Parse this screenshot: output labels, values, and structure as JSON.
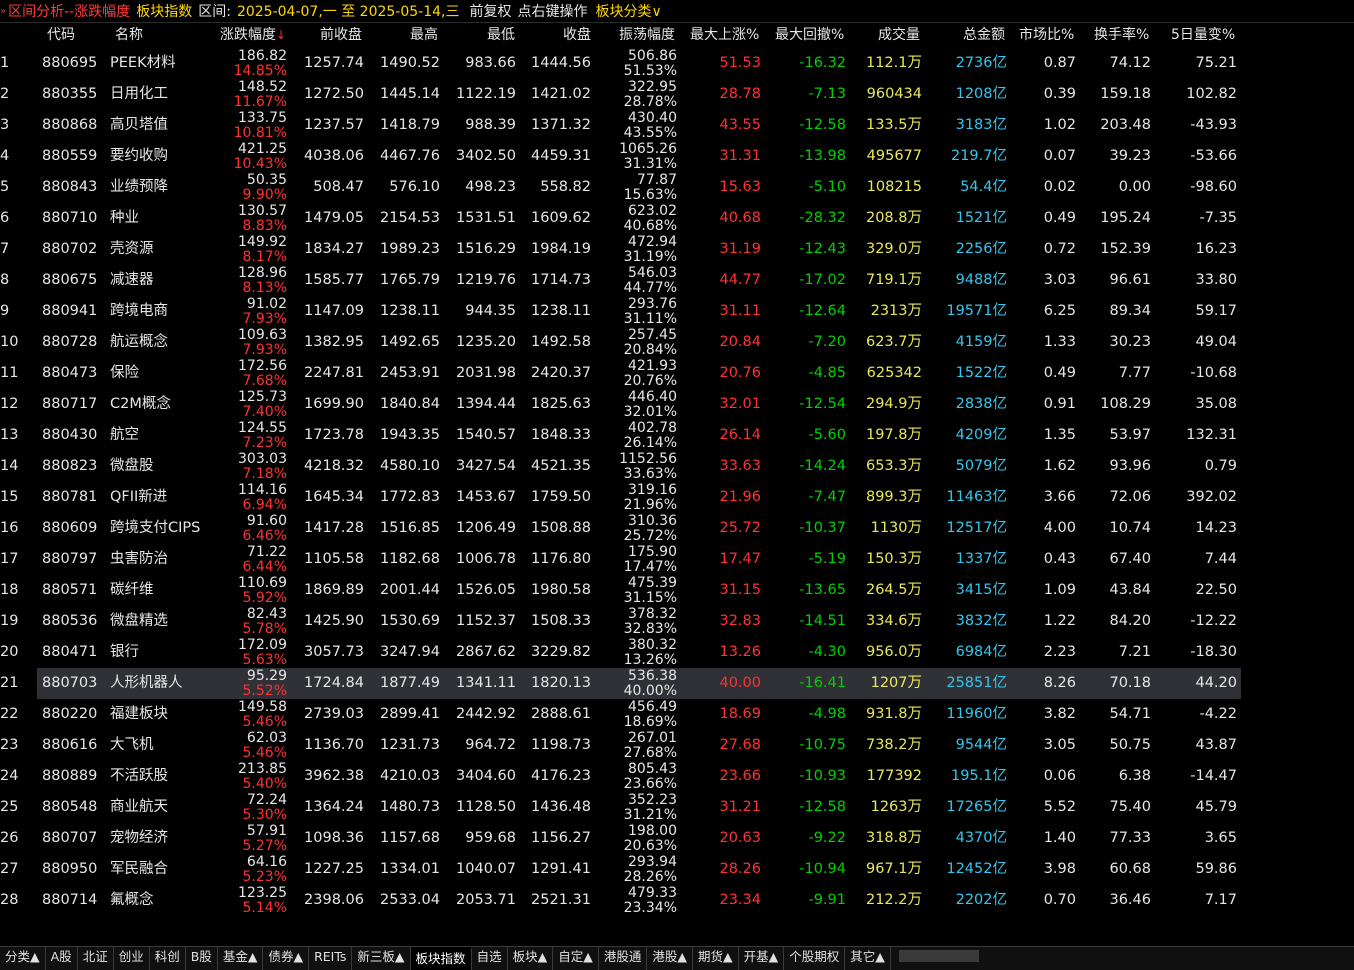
{
  "topbar": {
    "title": "区间分析--涨跌幅度",
    "board": "板块指数",
    "range_label": "区间:",
    "range_value": "2025-04-07,一 至 2025-05-14,三",
    "option1": "前复权",
    "option2": "点右键操作",
    "category": "板块分类∨"
  },
  "columns": {
    "code": "代码",
    "name": "名称",
    "change": "涨跌幅度",
    "sort_arrow": "↓",
    "prev_close": "前收盘",
    "high": "最高",
    "low": "最低",
    "close": "收盘",
    "amplitude": "振荡幅度",
    "max_rise": "最大上涨%",
    "max_drawdown": "最大回撤%",
    "volume": "成交量",
    "amount": "总金额",
    "market_ratio": "市场比%",
    "turnover": "换手率%",
    "vol5": "5日量变%"
  },
  "rows": [
    {
      "idx": "1",
      "code": "880695",
      "name": "PEEK材料",
      "chg": "186.82",
      "chg_pct": "14.85%",
      "prev": "1257.74",
      "high": "1490.52",
      "low": "983.66",
      "close": "1444.56",
      "amp": "506.86",
      "amp_pct": "51.53%",
      "rise": "51.53",
      "dd": "-16.32",
      "vol": "112.1万",
      "amt": "2736亿",
      "mkt": "0.87",
      "turn": "74.12",
      "v5": "75.21"
    },
    {
      "idx": "2",
      "code": "880355",
      "name": "日用化工",
      "chg": "148.52",
      "chg_pct": "11.67%",
      "prev": "1272.50",
      "high": "1445.14",
      "low": "1122.19",
      "close": "1421.02",
      "amp": "322.95",
      "amp_pct": "28.78%",
      "rise": "28.78",
      "dd": "-7.13",
      "vol": "960434",
      "amt": "1208亿",
      "mkt": "0.39",
      "turn": "159.18",
      "v5": "102.82"
    },
    {
      "idx": "3",
      "code": "880868",
      "name": "高贝塔值",
      "chg": "133.75",
      "chg_pct": "10.81%",
      "prev": "1237.57",
      "high": "1418.79",
      "low": "988.39",
      "close": "1371.32",
      "amp": "430.40",
      "amp_pct": "43.55%",
      "rise": "43.55",
      "dd": "-12.58",
      "vol": "133.5万",
      "amt": "3183亿",
      "mkt": "1.02",
      "turn": "203.48",
      "v5": "-43.93"
    },
    {
      "idx": "4",
      "code": "880559",
      "name": "要约收购",
      "chg": "421.25",
      "chg_pct": "10.43%",
      "prev": "4038.06",
      "high": "4467.76",
      "low": "3402.50",
      "close": "4459.31",
      "amp": "1065.26",
      "amp_pct": "31.31%",
      "rise": "31.31",
      "dd": "-13.98",
      "vol": "495677",
      "amt": "219.7亿",
      "mkt": "0.07",
      "turn": "39.23",
      "v5": "-53.66"
    },
    {
      "idx": "5",
      "code": "880843",
      "name": "业绩预降",
      "chg": "50.35",
      "chg_pct": "9.90%",
      "prev": "508.47",
      "high": "576.10",
      "low": "498.23",
      "close": "558.82",
      "amp": "77.87",
      "amp_pct": "15.63%",
      "rise": "15.63",
      "dd": "-5.10",
      "vol": "108215",
      "amt": "54.4亿",
      "mkt": "0.02",
      "turn": "0.00",
      "v5": "-98.60"
    },
    {
      "idx": "6",
      "code": "880710",
      "name": "种业",
      "chg": "130.57",
      "chg_pct": "8.83%",
      "prev": "1479.05",
      "high": "2154.53",
      "low": "1531.51",
      "close": "1609.62",
      "amp": "623.02",
      "amp_pct": "40.68%",
      "rise": "40.68",
      "dd": "-28.32",
      "vol": "208.8万",
      "amt": "1521亿",
      "mkt": "0.49",
      "turn": "195.24",
      "v5": "-7.35"
    },
    {
      "idx": "7",
      "code": "880702",
      "name": "壳资源",
      "chg": "149.92",
      "chg_pct": "8.17%",
      "prev": "1834.27",
      "high": "1989.23",
      "low": "1516.29",
      "close": "1984.19",
      "amp": "472.94",
      "amp_pct": "31.19%",
      "rise": "31.19",
      "dd": "-12.43",
      "vol": "329.0万",
      "amt": "2256亿",
      "mkt": "0.72",
      "turn": "152.39",
      "v5": "16.23"
    },
    {
      "idx": "8",
      "code": "880675",
      "name": "减速器",
      "chg": "128.96",
      "chg_pct": "8.13%",
      "prev": "1585.77",
      "high": "1765.79",
      "low": "1219.76",
      "close": "1714.73",
      "amp": "546.03",
      "amp_pct": "44.77%",
      "rise": "44.77",
      "dd": "-17.02",
      "vol": "719.1万",
      "amt": "9488亿",
      "mkt": "3.03",
      "turn": "96.61",
      "v5": "33.80"
    },
    {
      "idx": "9",
      "code": "880941",
      "name": "跨境电商",
      "chg": "91.02",
      "chg_pct": "7.93%",
      "prev": "1147.09",
      "high": "1238.11",
      "low": "944.35",
      "close": "1238.11",
      "amp": "293.76",
      "amp_pct": "31.11%",
      "rise": "31.11",
      "dd": "-12.64",
      "vol": "2313万",
      "amt": "19571亿",
      "mkt": "6.25",
      "turn": "89.34",
      "v5": "59.17"
    },
    {
      "idx": "10",
      "code": "880728",
      "name": "航运概念",
      "chg": "109.63",
      "chg_pct": "7.93%",
      "prev": "1382.95",
      "high": "1492.65",
      "low": "1235.20",
      "close": "1492.58",
      "amp": "257.45",
      "amp_pct": "20.84%",
      "rise": "20.84",
      "dd": "-7.20",
      "vol": "623.7万",
      "amt": "4159亿",
      "mkt": "1.33",
      "turn": "30.23",
      "v5": "49.04"
    },
    {
      "idx": "11",
      "code": "880473",
      "name": "保险",
      "chg": "172.56",
      "chg_pct": "7.68%",
      "prev": "2247.81",
      "high": "2453.91",
      "low": "2031.98",
      "close": "2420.37",
      "amp": "421.93",
      "amp_pct": "20.76%",
      "rise": "20.76",
      "dd": "-4.85",
      "vol": "625342",
      "amt": "1522亿",
      "mkt": "0.49",
      "turn": "7.77",
      "v5": "-10.68"
    },
    {
      "idx": "12",
      "code": "880717",
      "name": "C2M概念",
      "chg": "125.73",
      "chg_pct": "7.40%",
      "prev": "1699.90",
      "high": "1840.84",
      "low": "1394.44",
      "close": "1825.63",
      "amp": "446.40",
      "amp_pct": "32.01%",
      "rise": "32.01",
      "dd": "-12.54",
      "vol": "294.9万",
      "amt": "2838亿",
      "mkt": "0.91",
      "turn": "108.29",
      "v5": "35.08"
    },
    {
      "idx": "13",
      "code": "880430",
      "name": "航空",
      "chg": "124.55",
      "chg_pct": "7.23%",
      "prev": "1723.78",
      "high": "1943.35",
      "low": "1540.57",
      "close": "1848.33",
      "amp": "402.78",
      "amp_pct": "26.14%",
      "rise": "26.14",
      "dd": "-5.60",
      "vol": "197.8万",
      "amt": "4209亿",
      "mkt": "1.35",
      "turn": "53.97",
      "v5": "132.31"
    },
    {
      "idx": "14",
      "code": "880823",
      "name": "微盘股",
      "chg": "303.03",
      "chg_pct": "7.18%",
      "prev": "4218.32",
      "high": "4580.10",
      "low": "3427.54",
      "close": "4521.35",
      "amp": "1152.56",
      "amp_pct": "33.63%",
      "rise": "33.63",
      "dd": "-14.24",
      "vol": "653.3万",
      "amt": "5079亿",
      "mkt": "1.62",
      "turn": "93.96",
      "v5": "0.79"
    },
    {
      "idx": "15",
      "code": "880781",
      "name": "QFII新进",
      "chg": "114.16",
      "chg_pct": "6.94%",
      "prev": "1645.34",
      "high": "1772.83",
      "low": "1453.67",
      "close": "1759.50",
      "amp": "319.16",
      "amp_pct": "21.96%",
      "rise": "21.96",
      "dd": "-7.47",
      "vol": "899.3万",
      "amt": "11463亿",
      "mkt": "3.66",
      "turn": "72.06",
      "v5": "392.02"
    },
    {
      "idx": "16",
      "code": "880609",
      "name": "跨境支付CIPS",
      "chg": "91.60",
      "chg_pct": "6.46%",
      "prev": "1417.28",
      "high": "1516.85",
      "low": "1206.49",
      "close": "1508.88",
      "amp": "310.36",
      "amp_pct": "25.72%",
      "rise": "25.72",
      "dd": "-10.37",
      "vol": "1130万",
      "amt": "12517亿",
      "mkt": "4.00",
      "turn": "10.74",
      "v5": "14.23"
    },
    {
      "idx": "17",
      "code": "880797",
      "name": "虫害防治",
      "chg": "71.22",
      "chg_pct": "6.44%",
      "prev": "1105.58",
      "high": "1182.68",
      "low": "1006.78",
      "close": "1176.80",
      "amp": "175.90",
      "amp_pct": "17.47%",
      "rise": "17.47",
      "dd": "-5.19",
      "vol": "150.3万",
      "amt": "1337亿",
      "mkt": "0.43",
      "turn": "67.40",
      "v5": "7.44"
    },
    {
      "idx": "18",
      "code": "880571",
      "name": "碳纤维",
      "chg": "110.69",
      "chg_pct": "5.92%",
      "prev": "1869.89",
      "high": "2001.44",
      "low": "1526.05",
      "close": "1980.58",
      "amp": "475.39",
      "amp_pct": "31.15%",
      "rise": "31.15",
      "dd": "-13.65",
      "vol": "264.5万",
      "amt": "3415亿",
      "mkt": "1.09",
      "turn": "43.84",
      "v5": "22.50"
    },
    {
      "idx": "19",
      "code": "880536",
      "name": "微盘精选",
      "chg": "82.43",
      "chg_pct": "5.78%",
      "prev": "1425.90",
      "high": "1530.69",
      "low": "1152.37",
      "close": "1508.33",
      "amp": "378.32",
      "amp_pct": "32.83%",
      "rise": "32.83",
      "dd": "-14.51",
      "vol": "334.6万",
      "amt": "3832亿",
      "mkt": "1.22",
      "turn": "84.20",
      "v5": "-12.22"
    },
    {
      "idx": "20",
      "code": "880471",
      "name": "银行",
      "chg": "172.09",
      "chg_pct": "5.63%",
      "prev": "3057.73",
      "high": "3247.94",
      "low": "2867.62",
      "close": "3229.82",
      "amp": "380.32",
      "amp_pct": "13.26%",
      "rise": "13.26",
      "dd": "-4.30",
      "vol": "956.0万",
      "amt": "6984亿",
      "mkt": "2.23",
      "turn": "7.21",
      "v5": "-18.30"
    },
    {
      "idx": "21",
      "code": "880703",
      "name": "人形机器人",
      "chg": "95.29",
      "chg_pct": "5.52%",
      "prev": "1724.84",
      "high": "1877.49",
      "low": "1341.11",
      "close": "1820.13",
      "amp": "536.38",
      "amp_pct": "40.00%",
      "rise": "40.00",
      "dd": "-16.41",
      "vol": "1207万",
      "amt": "25851亿",
      "mkt": "8.26",
      "turn": "70.18",
      "v5": "44.20",
      "selected": true
    },
    {
      "idx": "22",
      "code": "880220",
      "name": "福建板块",
      "chg": "149.58",
      "chg_pct": "5.46%",
      "prev": "2739.03",
      "high": "2899.41",
      "low": "2442.92",
      "close": "2888.61",
      "amp": "456.49",
      "amp_pct": "18.69%",
      "rise": "18.69",
      "dd": "-4.98",
      "vol": "931.8万",
      "amt": "11960亿",
      "mkt": "3.82",
      "turn": "54.71",
      "v5": "-4.22"
    },
    {
      "idx": "23",
      "code": "880616",
      "name": "大飞机",
      "chg": "62.03",
      "chg_pct": "5.46%",
      "prev": "1136.70",
      "high": "1231.73",
      "low": "964.72",
      "close": "1198.73",
      "amp": "267.01",
      "amp_pct": "27.68%",
      "rise": "27.68",
      "dd": "-10.75",
      "vol": "738.2万",
      "amt": "9544亿",
      "mkt": "3.05",
      "turn": "50.75",
      "v5": "43.87"
    },
    {
      "idx": "24",
      "code": "880889",
      "name": "不活跃股",
      "chg": "213.85",
      "chg_pct": "5.40%",
      "prev": "3962.38",
      "high": "4210.03",
      "low": "3404.60",
      "close": "4176.23",
      "amp": "805.43",
      "amp_pct": "23.66%",
      "rise": "23.66",
      "dd": "-10.93",
      "vol": "177392",
      "amt": "195.1亿",
      "mkt": "0.06",
      "turn": "6.38",
      "v5": "-14.47"
    },
    {
      "idx": "25",
      "code": "880548",
      "name": "商业航天",
      "chg": "72.24",
      "chg_pct": "5.30%",
      "prev": "1364.24",
      "high": "1480.73",
      "low": "1128.50",
      "close": "1436.48",
      "amp": "352.23",
      "amp_pct": "31.21%",
      "rise": "31.21",
      "dd": "-12.58",
      "vol": "1263万",
      "amt": "17265亿",
      "mkt": "5.52",
      "turn": "75.40",
      "v5": "45.79"
    },
    {
      "idx": "26",
      "code": "880707",
      "name": "宠物经济",
      "chg": "57.91",
      "chg_pct": "5.27%",
      "prev": "1098.36",
      "high": "1157.68",
      "low": "959.68",
      "close": "1156.27",
      "amp": "198.00",
      "amp_pct": "20.63%",
      "rise": "20.63",
      "dd": "-9.22",
      "vol": "318.8万",
      "amt": "4370亿",
      "mkt": "1.40",
      "turn": "77.33",
      "v5": "3.65"
    },
    {
      "idx": "27",
      "code": "880950",
      "name": "军民融合",
      "chg": "64.16",
      "chg_pct": "5.23%",
      "prev": "1227.25",
      "high": "1334.01",
      "low": "1040.07",
      "close": "1291.41",
      "amp": "293.94",
      "amp_pct": "28.26%",
      "rise": "28.26",
      "dd": "-10.94",
      "vol": "967.1万",
      "amt": "12452亿",
      "mkt": "3.98",
      "turn": "60.68",
      "v5": "59.86"
    },
    {
      "idx": "28",
      "code": "880714",
      "name": "氟概念",
      "chg": "123.25",
      "chg_pct": "5.14%",
      "prev": "2398.06",
      "high": "2533.04",
      "low": "2053.71",
      "close": "2521.31",
      "amp": "479.33",
      "amp_pct": "23.34%",
      "rise": "23.34",
      "dd": "-9.91",
      "vol": "212.2万",
      "amt": "2202亿",
      "mkt": "0.70",
      "turn": "36.46",
      "v5": "7.17"
    }
  ],
  "tabs": [
    {
      "label": "分类▲",
      "active": false
    },
    {
      "label": "A股",
      "active": false
    },
    {
      "label": "北证",
      "active": false
    },
    {
      "label": "创业",
      "active": false
    },
    {
      "label": "科创",
      "active": false
    },
    {
      "label": "B股",
      "active": false
    },
    {
      "label": "基金▲",
      "active": false
    },
    {
      "label": "债券▲",
      "active": false
    },
    {
      "label": "REITs",
      "active": false
    },
    {
      "label": "新三板▲",
      "active": false
    },
    {
      "label": "板块指数",
      "active": true
    },
    {
      "label": "自选",
      "active": false
    },
    {
      "label": "板块▲",
      "active": false
    },
    {
      "label": "自定▲",
      "active": false
    },
    {
      "label": "港股通",
      "active": false
    },
    {
      "label": "港股▲",
      "active": false
    },
    {
      "label": "期货▲",
      "active": false
    },
    {
      "label": "开基▲",
      "active": false
    },
    {
      "label": "个股期权",
      "active": false
    },
    {
      "label": "其它▲",
      "active": false
    }
  ],
  "colors": {
    "up": "#ff3232",
    "down": "#00d100",
    "volume": "#e8e85a",
    "amount": "#33c6ee",
    "title": "#ff3c3c",
    "board": "#ffd700"
  }
}
